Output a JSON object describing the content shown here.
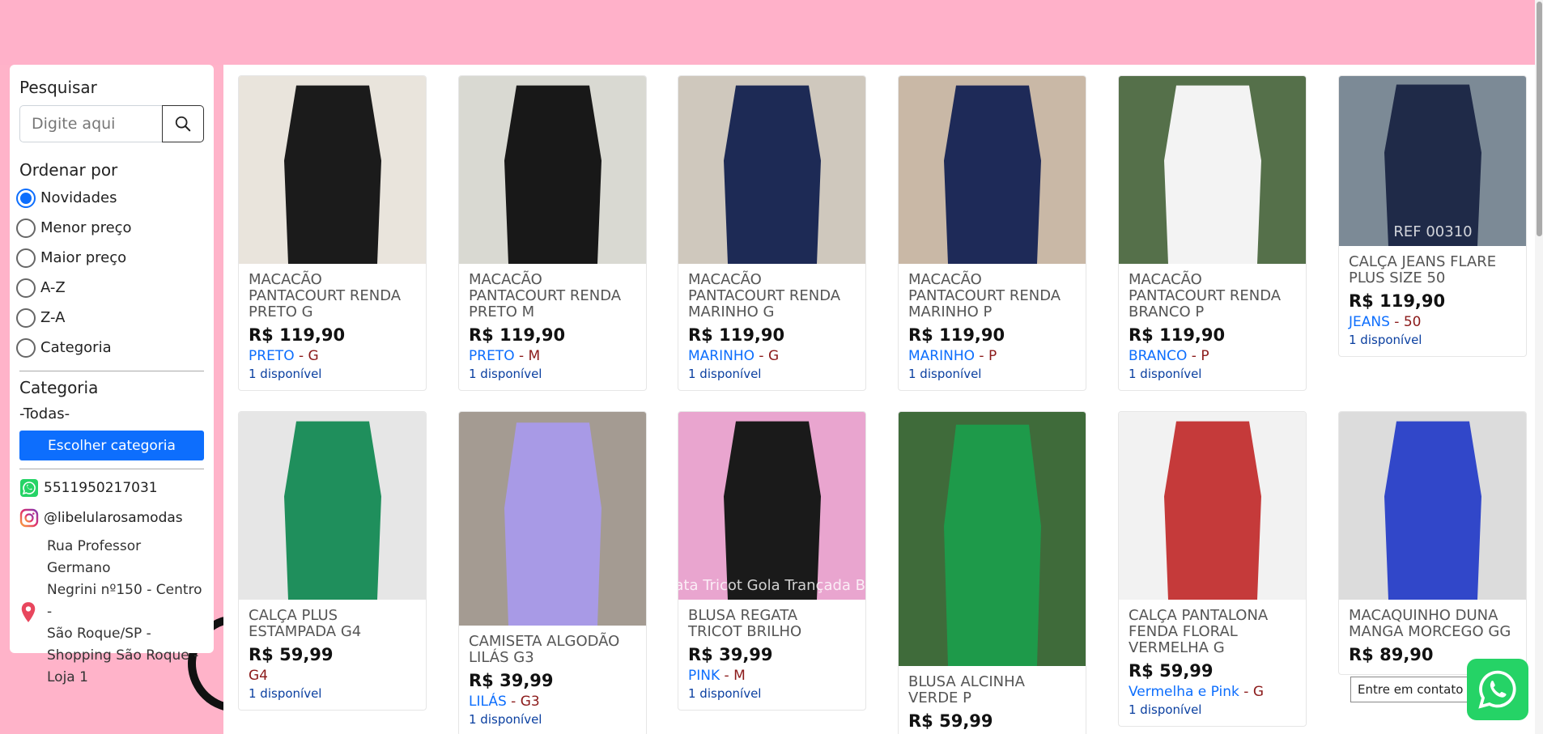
{
  "sidebar": {
    "search_heading": "Pesquisar",
    "search_placeholder": "Digite aqui",
    "sort_heading": "Ordenar por",
    "sort_options": [
      "Novidades",
      "Menor preço",
      "Maior preço",
      "A-Z",
      "Z-A",
      "Categoria"
    ],
    "sort_selected": "Novidades",
    "category_heading": "Categoria",
    "category_value": "-Todas-",
    "category_button": "Escolher categoria",
    "whatsapp_number": "5511950217031",
    "instagram_handle": "@libelularosamodas",
    "address": "Rua Professor Germano Negrini nº150 - Centro - São Roque/SP - Shopping São Roque - Loja 1",
    "address_lines": [
      "Rua Professor Germano",
      "Negrini nº150 - Centro -",
      "São Roque/SP -",
      "Shopping São Roque -",
      "Loja 1"
    ]
  },
  "products": [
    {
      "name": "MACACÃO PANTACOURT RENDA PRETO G",
      "price": "R$ 119,90",
      "color": "PRETO",
      "sep": " - ",
      "size": "G",
      "availability": "1 disponível",
      "img_color": "#1b1b1b",
      "img_bg": "#e9e4dc"
    },
    {
      "name": "MACACÃO PANTACOURT RENDA PRETO M",
      "price": "R$ 119,90",
      "color": "PRETO",
      "sep": " - ",
      "size": "M",
      "availability": "1 disponível",
      "img_color": "#181818",
      "img_bg": "#d9d9d2"
    },
    {
      "name": "MACACÃO PANTACOURT RENDA MARINHO G",
      "price": "R$ 119,90",
      "color": "MARINHO",
      "sep": " - ",
      "size": "G",
      "availability": "1 disponível",
      "img_color": "#1d2a55",
      "img_bg": "#cfc8bd"
    },
    {
      "name": "MACACÃO PANTACOURT RENDA MARINHO P",
      "price": "R$ 119,90",
      "color": "MARINHO",
      "sep": " - ",
      "size": "P",
      "availability": "1 disponível",
      "img_color": "#1e2a58",
      "img_bg": "#c9b8a6"
    },
    {
      "name": "MACACÃO PANTACOURT RENDA BRANCO P",
      "price": "R$ 119,90",
      "color": "BRANCO",
      "sep": " - ",
      "size": "P",
      "availability": "1 disponível",
      "img_color": "#f3f3f3",
      "img_bg": "#55704a"
    },
    {
      "name": "CALÇA JEANS FLARE PLUS SIZE 50",
      "price": "R$ 119,90",
      "color": "JEANS",
      "sep": " - ",
      "size": "50",
      "availability": "1 disponível",
      "img_color": "#1f2a48",
      "img_bg": "#7c8a96",
      "img_text": "REF 00310"
    },
    {
      "name": "CALÇA PLUS ESTAMPADA G4",
      "price": "R$ 59,99",
      "color": "",
      "sep": "",
      "size": "G4",
      "availability": "1 disponível",
      "img_color": "#1f8f5c",
      "img_bg": "#e6e6e6"
    },
    {
      "name": "CAMISETA ALGODÃO LILÁS G3",
      "price": "R$ 39,99",
      "color": "LILÁS",
      "sep": " - ",
      "size": "G3",
      "availability": "1 disponível",
      "img_color": "#a89ae6",
      "img_bg": "#a49b92"
    },
    {
      "name": "BLUSA REGATA TRICOT BRILHO",
      "price": "R$ 39,99",
      "color": "PINK",
      "sep": " - ",
      "size": "M",
      "availability": "1 disponível",
      "img_color": "#1a1a1a",
      "img_bg": "#e9a5cf",
      "img_text": "Regata Tricot Gola Trançada Brilho"
    },
    {
      "name": "BLUSA ALCINHA VERDE P",
      "price": "R$ 59,99",
      "color": "",
      "sep": "",
      "size": "",
      "availability": "",
      "img_color": "#1e9a4a",
      "img_bg": "#3f6b3a"
    },
    {
      "name": "CALÇA PANTALONA FENDA FLORAL VERMELHA G",
      "price": "R$ 59,99",
      "color": "Vermelha e Pink",
      "sep": " - ",
      "size": "G",
      "availability": "1 disponível",
      "img_color": "#c53a3a",
      "img_bg": "#f2f2f2"
    },
    {
      "name": "MACAQUINHO DUNA MANGA MORCEGO GG",
      "price": "R$ 89,90",
      "color": "",
      "sep": "",
      "size": "",
      "availability": "",
      "img_color": "#3147c9",
      "img_bg": "#dcdcdc"
    }
  ],
  "whatsapp_tooltip": "Entre em contato"
}
